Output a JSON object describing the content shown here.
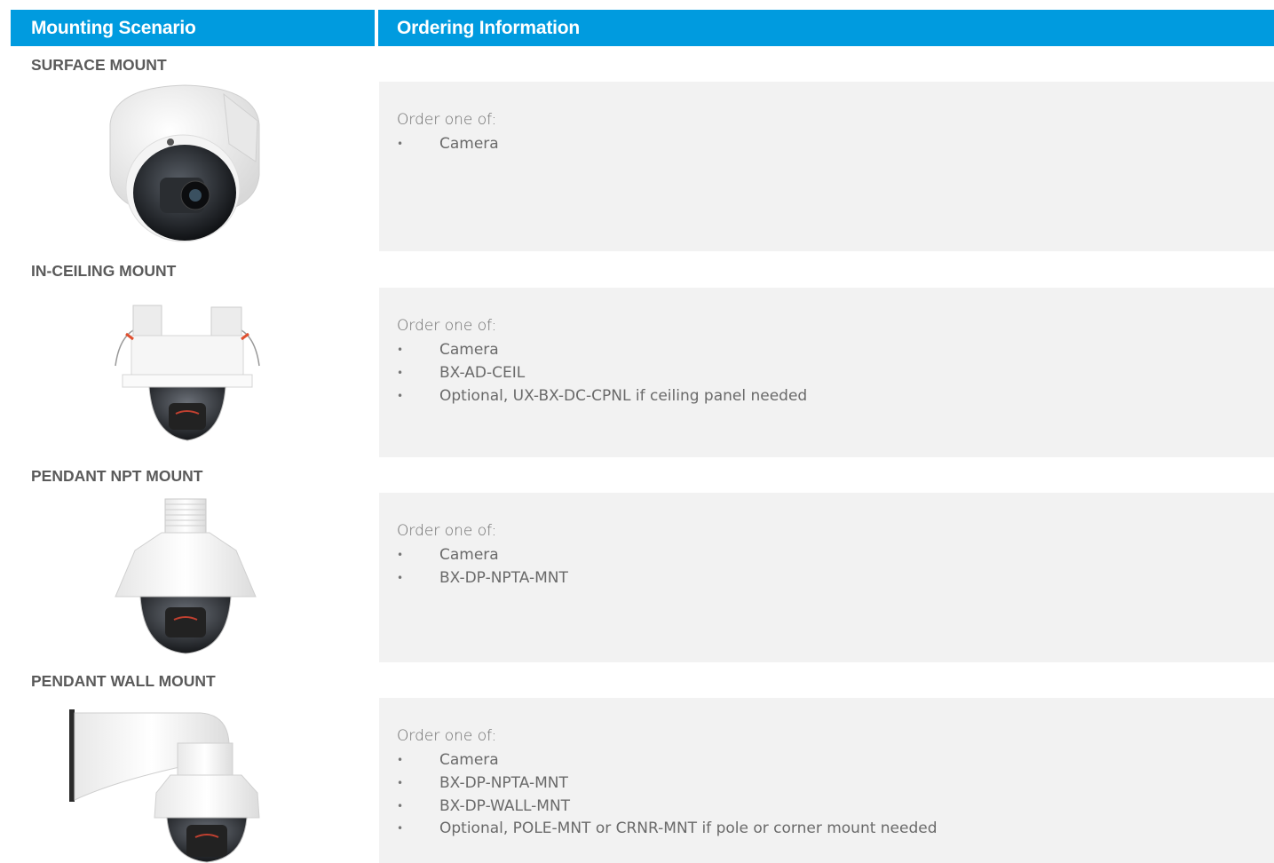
{
  "header": {
    "left": "Mounting Scenario",
    "right": "Ordering Information"
  },
  "mounts": [
    {
      "title": "SURFACE MOUNT",
      "lead": "Order one of:",
      "items": [
        "Camera"
      ]
    },
    {
      "title": "IN-CEILING MOUNT",
      "lead": "Order one of:",
      "items": [
        "Camera",
        "BX-AD-CEIL",
        "Optional, UX-BX-DC-CPNL if ceiling panel needed"
      ]
    },
    {
      "title": "PENDANT NPT MOUNT",
      "lead": "Order one of:",
      "items": [
        "Camera",
        "BX-DP-NPTA-MNT"
      ]
    },
    {
      "title": "PENDANT WALL MOUNT",
      "lead": "Order one of:",
      "items": [
        "Camera",
        "BX-DP-NPTA-MNT",
        "BX-DP-WALL-MNT",
        "Optional, POLE-MNT or CRNR-MNT if pole or corner mount needed"
      ]
    }
  ],
  "colors": {
    "header_bg": "#009bdf",
    "panel_bg": "#f2f2f2"
  }
}
